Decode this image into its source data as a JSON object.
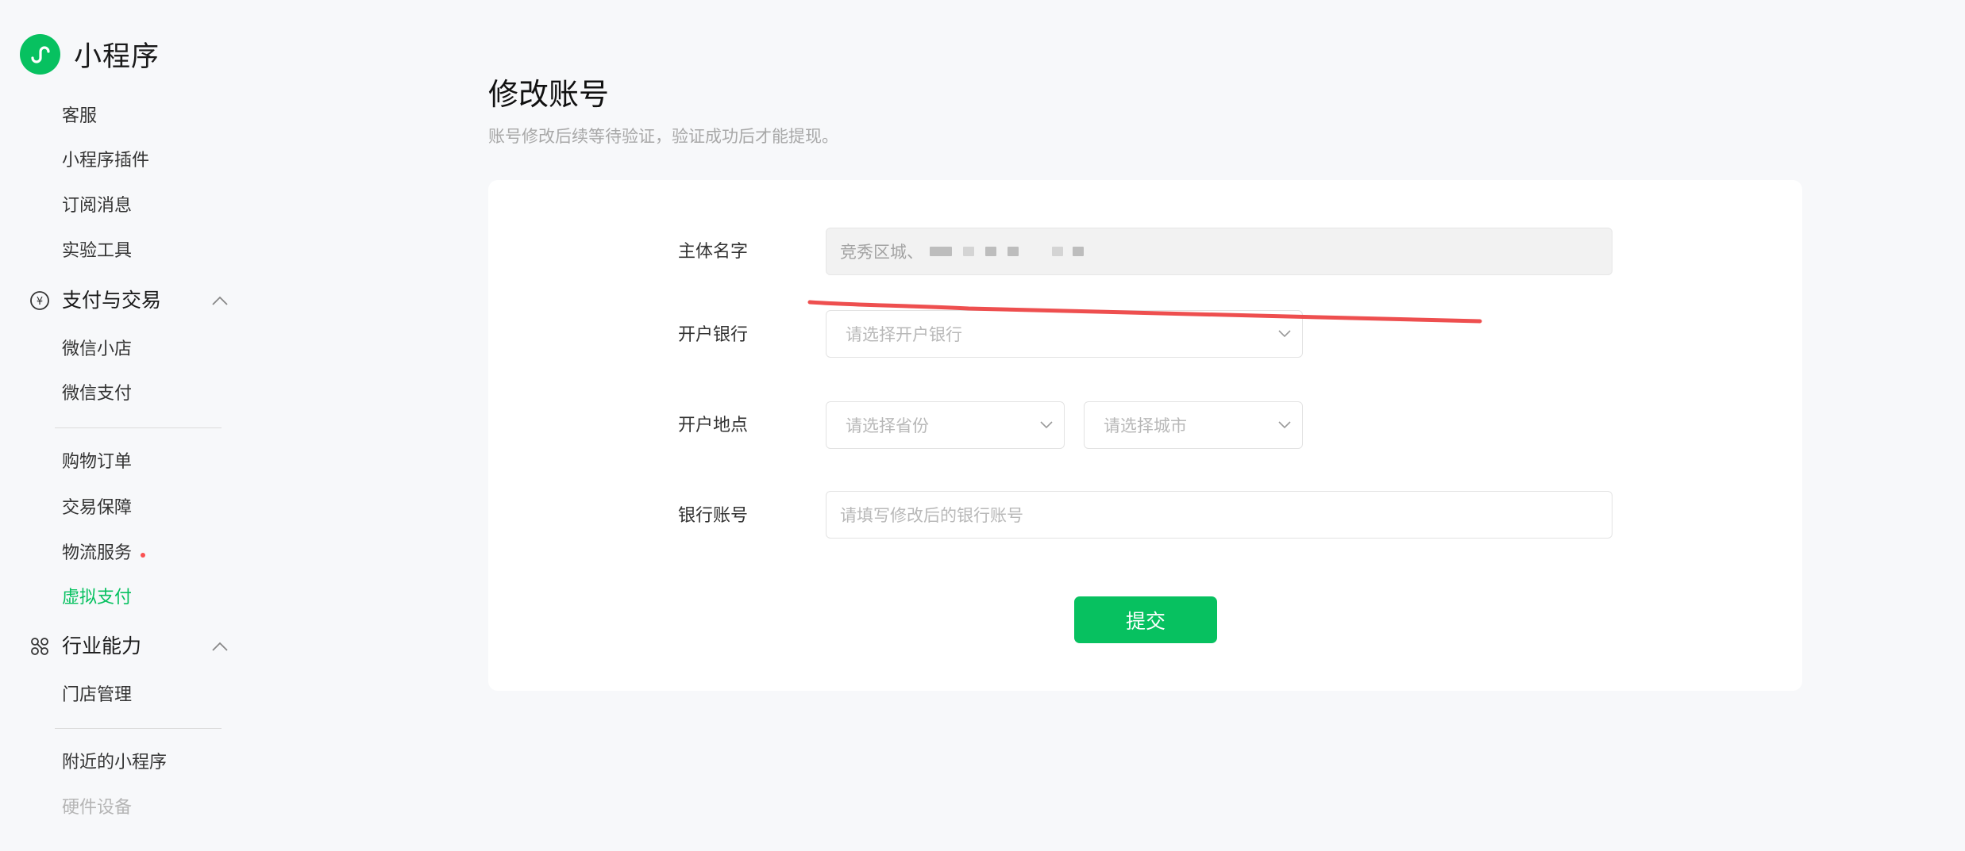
{
  "app": {
    "name": "小程序",
    "accent": "#07c160",
    "badge_color": "#fa5151"
  },
  "sidebar": {
    "items_top": [
      {
        "label": "客服"
      },
      {
        "label": "小程序插件"
      },
      {
        "label": "订阅消息"
      },
      {
        "label": "实验工具"
      }
    ],
    "group_payment": {
      "title": "支付与交易",
      "icon": "yen-circle-icon",
      "items": [
        {
          "label": "微信小店"
        },
        {
          "label": "微信支付"
        },
        {
          "label": "购物订单"
        },
        {
          "label": "交易保障"
        },
        {
          "label": "物流服务"
        },
        {
          "label": "虚拟支付"
        }
      ]
    },
    "group_industry": {
      "title": "行业能力",
      "icon": "industry-nodes-icon",
      "items": [
        {
          "label": "门店管理"
        },
        {
          "label": "附近的小程序"
        },
        {
          "label": "硬件设备"
        }
      ]
    }
  },
  "main": {
    "title": "修改账号",
    "subtitle": "账号修改后续等待验证，验证成功后才能提现。",
    "form": {
      "entity_name": {
        "label": "主体名字",
        "value": "竞秀区城"
      },
      "bank": {
        "label": "开户银行",
        "placeholder": "请选择开户银行"
      },
      "location": {
        "label": "开户地点",
        "province_placeholder": "请选择省份",
        "city_placeholder": "请选择城市"
      },
      "account": {
        "label": "银行账号",
        "placeholder": "请填写修改后的银行账号"
      },
      "submit_label": "提交"
    }
  }
}
